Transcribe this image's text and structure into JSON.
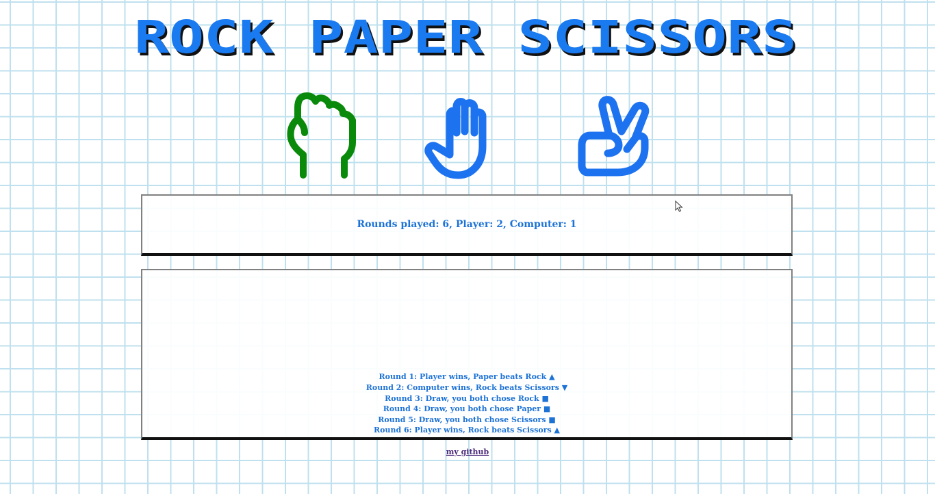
{
  "title": "ROCK PAPER SCISSORS",
  "choices": [
    {
      "name": "rock",
      "icon": "fist-icon",
      "color": "#0a8a0a"
    },
    {
      "name": "paper",
      "icon": "open-hand-icon",
      "color": "#1d72f0"
    },
    {
      "name": "scissors",
      "icon": "peace-hand-icon",
      "color": "#1d72f0"
    }
  ],
  "score": {
    "text": "Rounds played: 6, Player: 2, Computer: 1"
  },
  "log": [
    "Round 1: Player wins, Paper beats Rock ▲",
    "Round 2: Computer wins, Rock beats Scissors ▼",
    "Round 3: Draw, you both chose Rock ■",
    "Round 4: Draw, you both chose Paper ■",
    "Round 5: Draw, you both chose Scissors ■",
    "Round 6: Player wins, Rock beats Scissors ▲"
  ],
  "footer": {
    "link_label": "my github"
  },
  "colors": {
    "title_blue": "#1a7af0",
    "text_blue": "#1d72d6",
    "rock_green": "#0a8a0a",
    "grid_line": "#bfe0ee"
  }
}
